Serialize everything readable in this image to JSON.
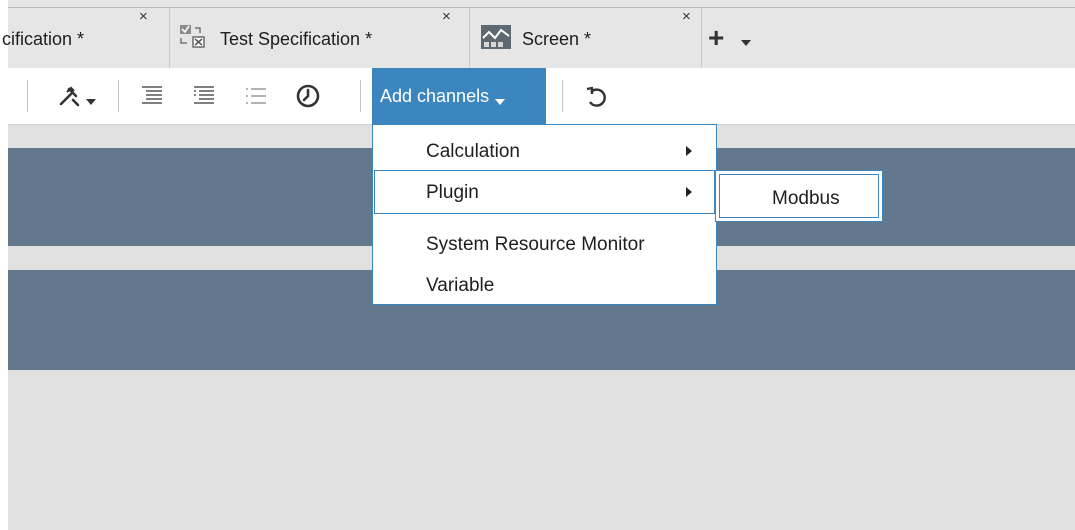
{
  "tabs": [
    {
      "label": "cification *",
      "close": "×"
    },
    {
      "label": "Test Specification *",
      "close": "×",
      "icon": "test-specification-icon"
    },
    {
      "label": "Screen *",
      "close": "×",
      "icon": "screen-chart-icon"
    }
  ],
  "tabstrip": {
    "add": "+"
  },
  "toolbar": {
    "add_channels_label": "Add channels",
    "icons": [
      "tools-icon",
      "list-indent-icon",
      "list-outdent-icon",
      "list-icon",
      "clock-icon",
      "refresh-icon"
    ]
  },
  "menu": {
    "items": [
      {
        "label": "Calculation",
        "has_submenu": true
      },
      {
        "label": "Plugin",
        "has_submenu": true,
        "highlighted": true
      },
      {
        "label": "System Resource Monitor",
        "has_submenu": false
      },
      {
        "label": "Variable",
        "has_submenu": false
      }
    ]
  },
  "submenu": {
    "items": [
      {
        "label": "Modbus"
      }
    ]
  },
  "colors": {
    "accent": "#3c86bf",
    "band": "#63788d",
    "background": "#e1e1e1"
  }
}
